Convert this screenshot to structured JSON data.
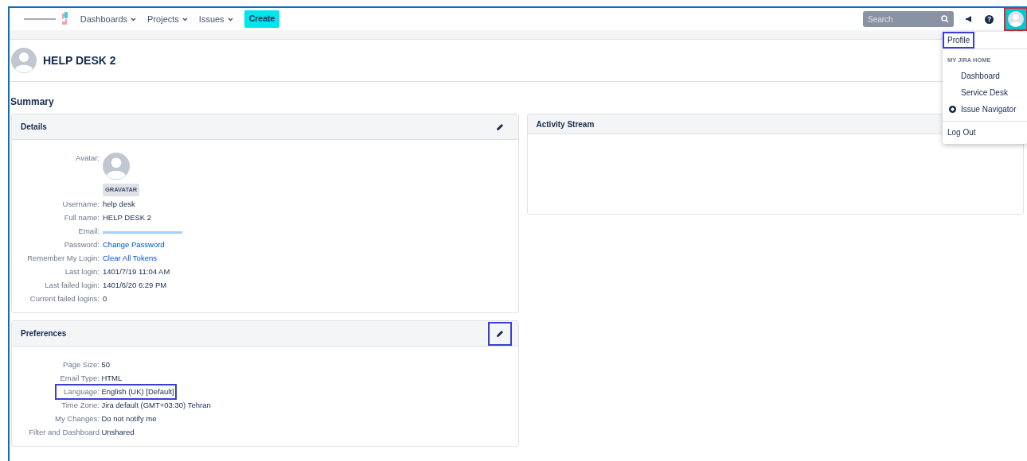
{
  "navbar": {
    "menus": [
      {
        "label": "Dashboards"
      },
      {
        "label": "Projects"
      },
      {
        "label": "Issues"
      }
    ],
    "create_button": "Create",
    "search": {
      "placeholder": "Search"
    },
    "help_glyph": "?",
    "user_button": {
      "outlined": true
    }
  },
  "user_menu": {
    "items": [
      {
        "kind": "link",
        "label": "Profile",
        "outlined": true,
        "selected": false
      },
      {
        "kind": "heading",
        "label": "MY JIRA HOME"
      },
      {
        "kind": "radio",
        "label": "Dashboard",
        "selected": false
      },
      {
        "kind": "radio",
        "label": "Service Desk",
        "selected": false
      },
      {
        "kind": "radio",
        "label": "Issue Navigator",
        "selected": true
      },
      {
        "kind": "divider"
      },
      {
        "kind": "link",
        "label": "Log Out",
        "outlined": false,
        "selected": false
      }
    ]
  },
  "page_title": "HELP DESK 2",
  "section_title": "Summary",
  "details": {
    "title": "Details",
    "edit_outlined": false,
    "avatar_label": "Avatar:",
    "avatar_badge": "GRAVATAR",
    "rows": [
      {
        "label": "Username:",
        "value": "help desk",
        "kind": "text"
      },
      {
        "label": "Full name:",
        "value": "HELP DESK 2",
        "kind": "text"
      },
      {
        "label": "Email:",
        "kind": "redacted"
      },
      {
        "label": "Password:",
        "value": "Change Password",
        "kind": "link"
      },
      {
        "label": "Remember My Login:",
        "value": "Clear All Tokens",
        "kind": "link"
      },
      {
        "label": "Last login:",
        "value": "1401/7/19 11:04 AM",
        "kind": "text"
      },
      {
        "label": "Last failed login:",
        "value": "1401/6/20 6:29 PM",
        "kind": "text"
      },
      {
        "label": "Current failed logins:",
        "value": "0",
        "kind": "text"
      }
    ]
  },
  "activity_stream": {
    "title": "Activity Stream"
  },
  "preferences": {
    "title": "Preferences",
    "edit_outlined": true,
    "rows": [
      {
        "label": "Page Size:",
        "value": "50",
        "outlined": false
      },
      {
        "label": "Email Type:",
        "value": "HTML",
        "outlined": false
      },
      {
        "label": "Language:",
        "value": "English (UK) [Default]",
        "outlined": true
      },
      {
        "label": "Time Zone:",
        "value": "Jira default (GMT+03:30) Tehran",
        "outlined": false
      },
      {
        "label": "My Changes:",
        "value": "Do not notify me",
        "outlined": false
      },
      {
        "label": "Filter and Dashboard",
        "value": "Unshared",
        "outlined": false
      }
    ]
  }
}
